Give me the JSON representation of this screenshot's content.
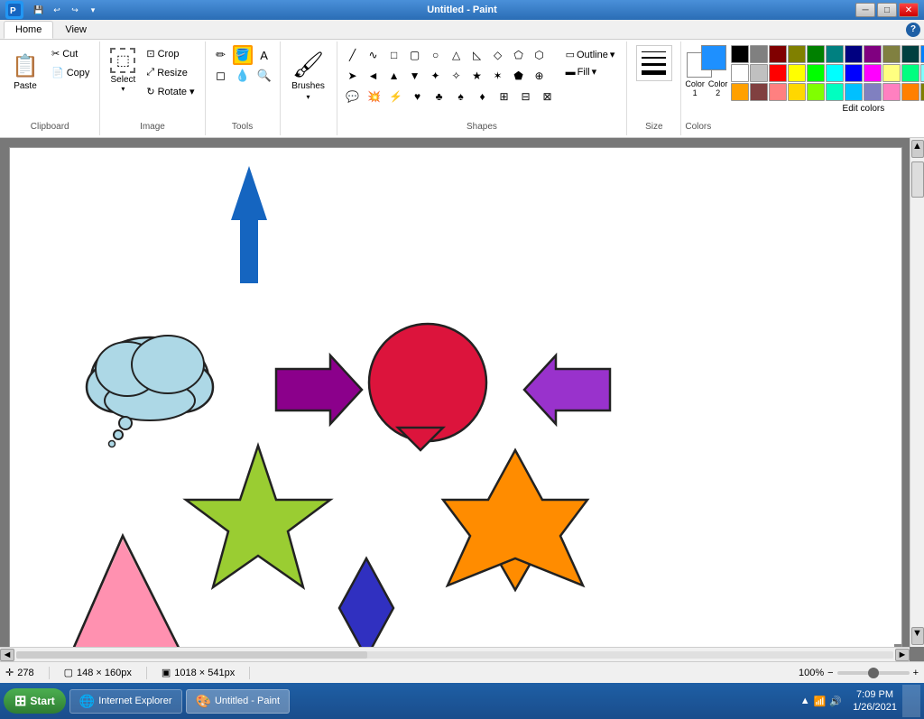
{
  "titlebar": {
    "title": "Untitled - Paint",
    "min_label": "─",
    "max_label": "□",
    "close_label": "✕"
  },
  "menubar": {
    "tabs": [
      {
        "id": "home",
        "label": "Home",
        "active": true
      },
      {
        "id": "view",
        "label": "View",
        "active": false
      }
    ]
  },
  "ribbon": {
    "clipboard": {
      "label": "Clipboard",
      "paste_label": "Paste",
      "cut_label": "Cut",
      "copy_label": "Copy"
    },
    "image": {
      "label": "Image",
      "crop_label": "Crop",
      "resize_label": "Resize",
      "rotate_label": "Rotate",
      "select_label": "Select"
    },
    "tools": {
      "label": "Tools"
    },
    "brushes": {
      "label": "Brushes"
    },
    "shapes": {
      "label": "Shapes",
      "outline_label": "Outline",
      "fill_label": "Fill"
    },
    "size": {
      "label": "Size"
    },
    "colors": {
      "label": "Colors",
      "color1_label": "Color 1",
      "color2_label": "Color 2",
      "edit_label": "Edit colors"
    }
  },
  "statusbar": {
    "coords": "278",
    "dimensions1": "148 × 160px",
    "dimensions2": "1018 × 541px",
    "zoom": "100%"
  },
  "taskbar": {
    "start_label": "Start",
    "items": [
      {
        "label": "Internet Explorer",
        "active": false
      },
      {
        "label": "Untitled - Paint",
        "active": true
      }
    ],
    "time": "7:09 PM",
    "date": "1/26/2021"
  },
  "colors": {
    "fg": "#1e90ff",
    "bg": "#ffffff",
    "palette": [
      "#000000",
      "#808080",
      "#800000",
      "#808000",
      "#008000",
      "#008080",
      "#000080",
      "#800080",
      "#808040",
      "#004040",
      "#0080ff",
      "#004080",
      "#8000ff",
      "#804000",
      "#ffffff",
      "#c0c0c0",
      "#ff0000",
      "#ffff00",
      "#00ff00",
      "#00ffff",
      "#0000ff",
      "#ff00ff",
      "#ffff80",
      "#00ff80",
      "#80ffff",
      "#8080ff",
      "#ff0080",
      "#ff8040",
      "#ffA000",
      "#804040",
      "#ff8080",
      "#ffd700",
      "#80ff00",
      "#00ffc0",
      "#00c0ff",
      "#8080c0",
      "#ff80c0",
      "#ff8000",
      "#808000",
      "#c0c000"
    ]
  }
}
